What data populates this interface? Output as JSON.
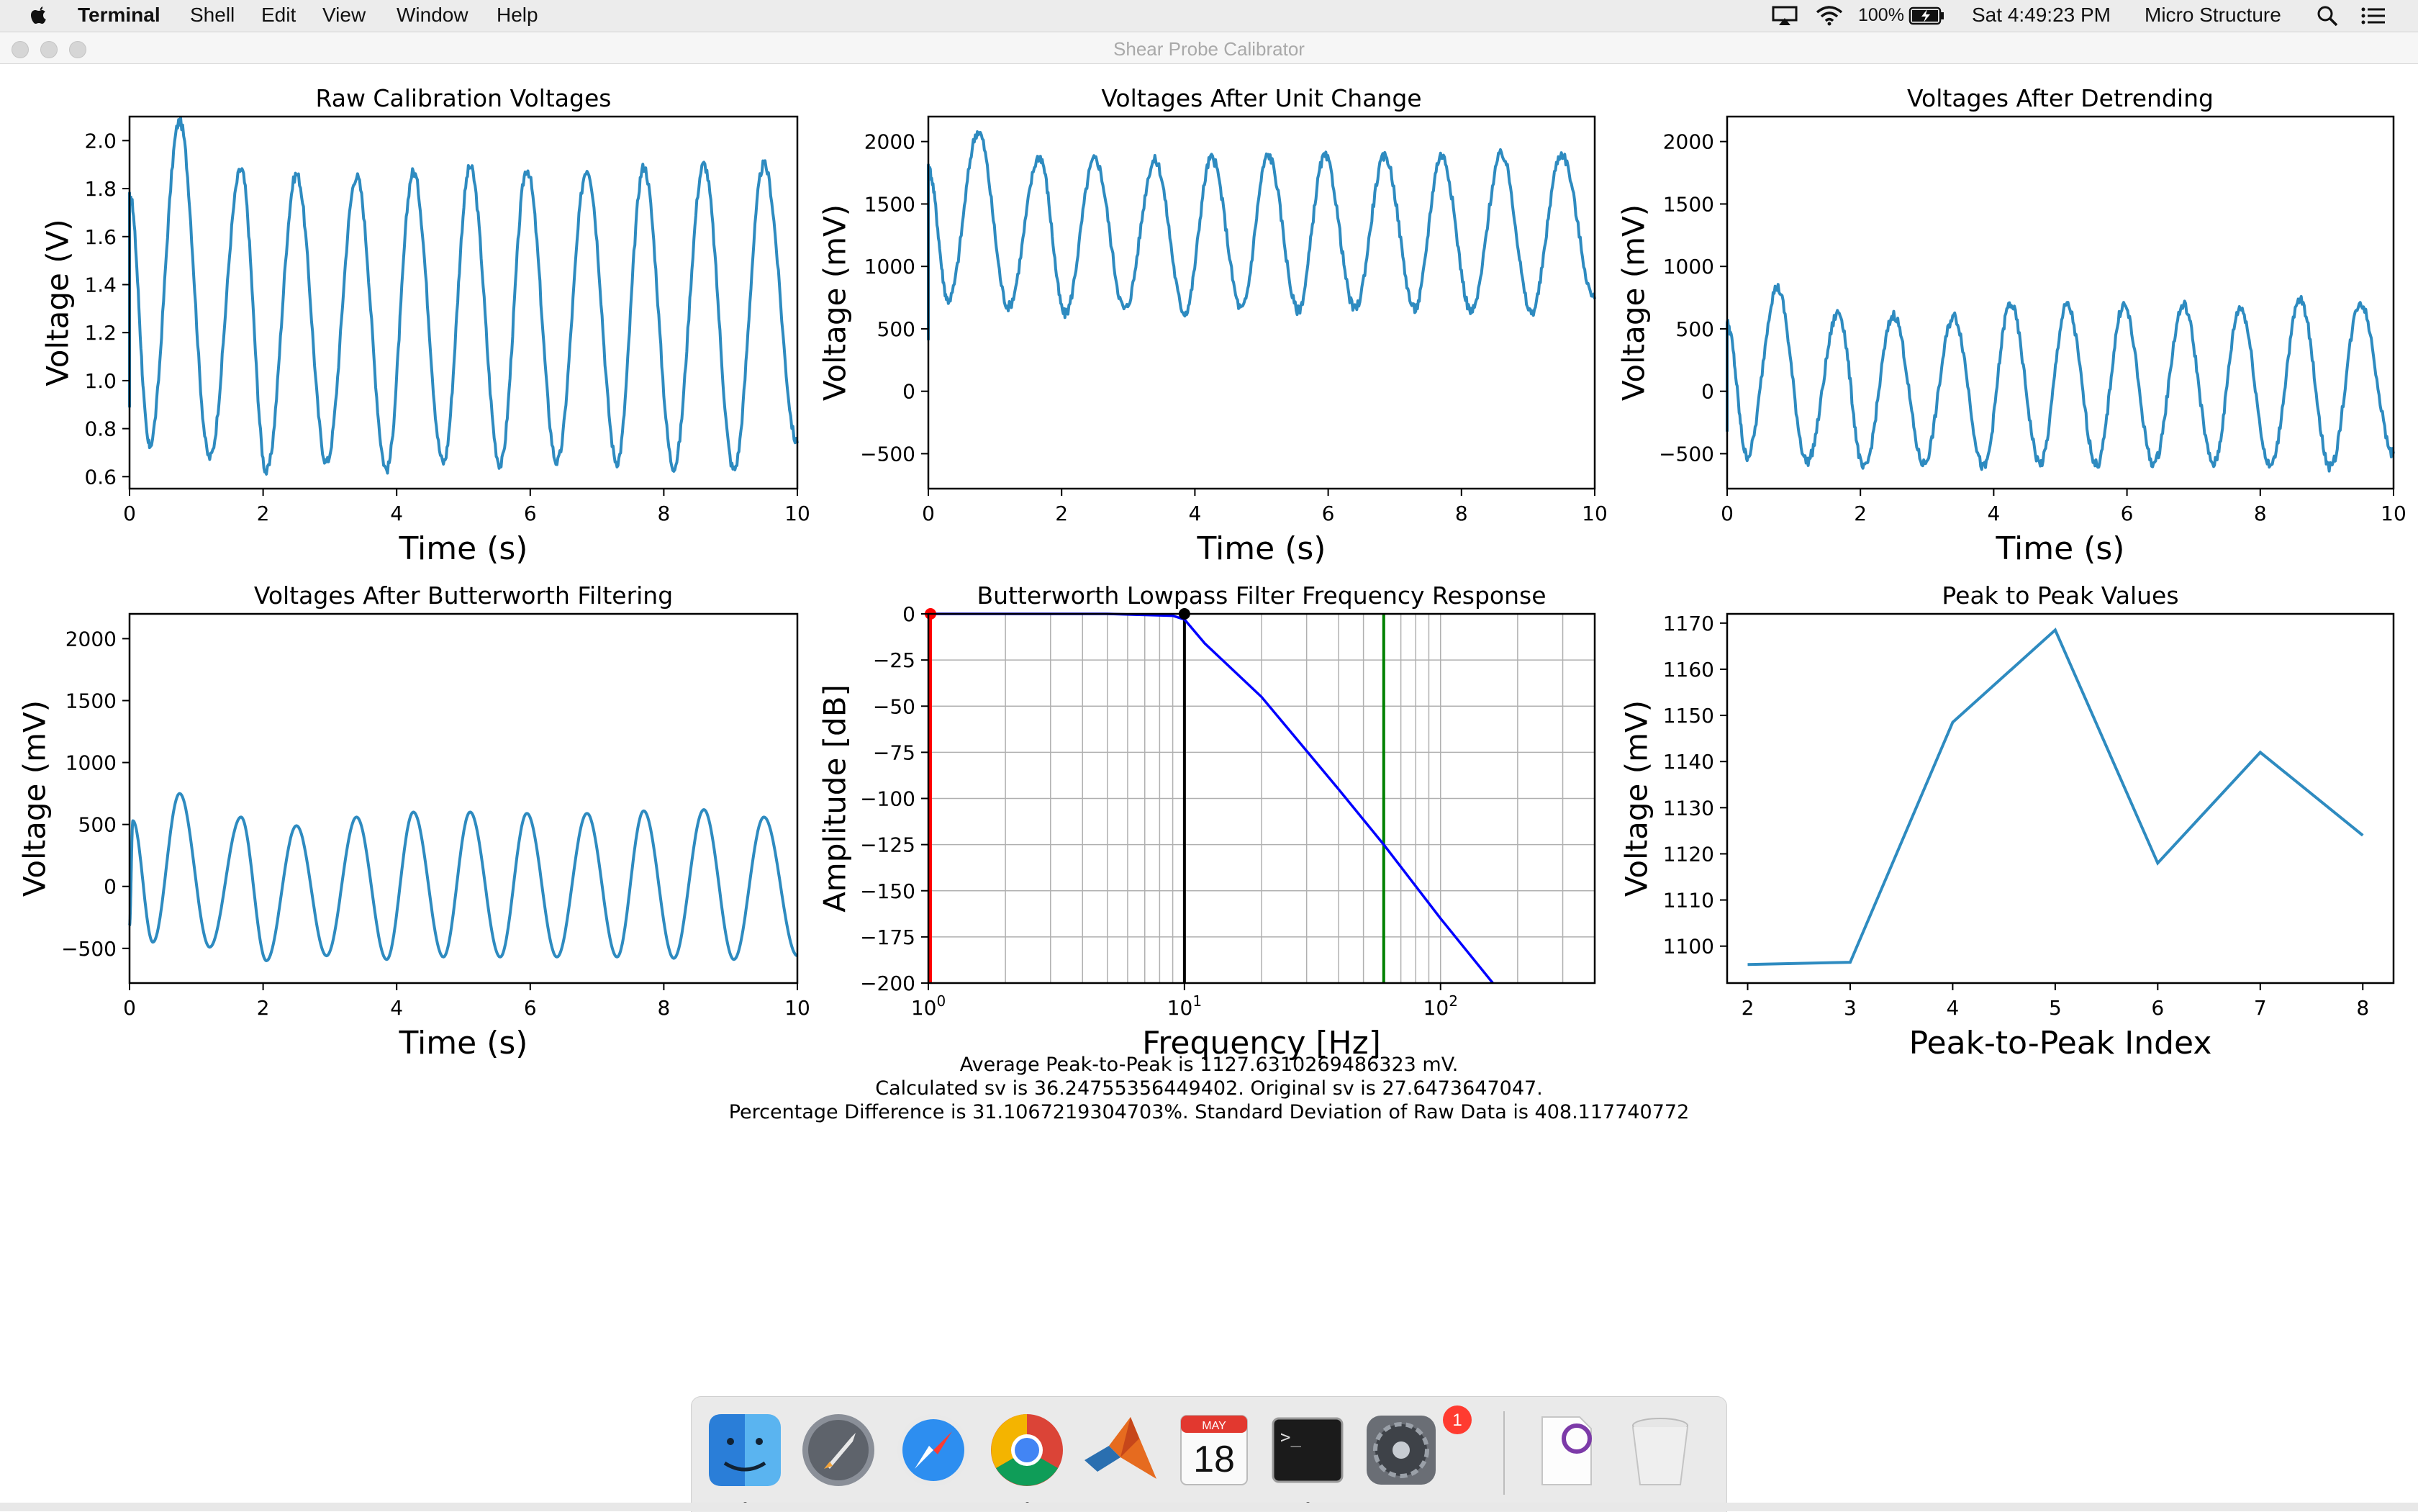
{
  "menubar": {
    "app_name": "Terminal",
    "items": [
      "Shell",
      "Edit",
      "View",
      "Window",
      "Help"
    ],
    "battery": "100%",
    "clock": "Sat 4:49:23 PM",
    "user": "Micro Structure",
    "icons": [
      "apple-icon",
      "airplay-icon",
      "wifi-icon",
      "battery-icon",
      "spotlight-search-icon",
      "notification-center-icon"
    ]
  },
  "window": {
    "title": "Shear Probe Calibrator"
  },
  "charts": {
    "raw": {
      "title": "Raw Calibration Voltages",
      "xlabel": "Time (s)",
      "ylabel": "Voltage (V)"
    },
    "unit": {
      "title": "Voltages After Unit Change",
      "xlabel": "Time (s)",
      "ylabel": "Voltage (mV)"
    },
    "detrend": {
      "title": "Voltages After Detrending",
      "xlabel": "Time (s)",
      "ylabel": "Voltage (mV)"
    },
    "butter": {
      "title": "Voltages After Butterworth Filtering",
      "xlabel": "Time (s)",
      "ylabel": "Voltage (mV)"
    },
    "freq": {
      "title": "Butterworth Lowpass Filter Frequency Response",
      "xlabel": "Frequency [Hz]",
      "ylabel": "Amplitude [dB]"
    },
    "p2p": {
      "title": "Peak to Peak Values",
      "xlabel": "Peak-to-Peak Index",
      "ylabel": "Voltage (mV)"
    }
  },
  "chart_data": [
    {
      "type": "line",
      "title": "Raw Calibration Voltages",
      "xlabel": "Time (s)",
      "ylabel": "Voltage (V)",
      "xlim": [
        0,
        10
      ],
      "ylim": [
        0.55,
        2.1
      ],
      "xticks": [
        "0",
        "2",
        "4",
        "6",
        "8",
        "10"
      ],
      "yticks": [
        "0.6",
        "0.8",
        "1.0",
        "1.2",
        "1.4",
        "1.6",
        "1.8",
        "2.0"
      ],
      "peak_times": [
        0.0,
        0.75,
        1.67,
        2.5,
        3.4,
        4.25,
        5.1,
        5.95,
        6.85,
        7.7,
        8.6,
        9.5
      ],
      "peaks": [
        1.78,
        2.08,
        1.88,
        1.86,
        1.85,
        1.87,
        1.89,
        1.88,
        1.88,
        1.89,
        1.9,
        1.9
      ],
      "trough_times": [
        0.3,
        1.2,
        2.05,
        2.95,
        3.85,
        4.7,
        5.55,
        6.4,
        7.3,
        8.15,
        9.05,
        10.0
      ],
      "troughs": [
        0.73,
        0.68,
        0.62,
        0.66,
        0.63,
        0.66,
        0.65,
        0.66,
        0.66,
        0.64,
        0.63,
        0.74
      ],
      "series": [
        {
          "values": "oscillating voltage, ~11 cycles over 10 s"
        }
      ],
      "color": "#2e8bc0"
    },
    {
      "type": "line",
      "title": "Voltages After Unit Change",
      "xlabel": "Time (s)",
      "ylabel": "Voltage (mV)",
      "xlim": [
        0,
        10
      ],
      "ylim": [
        -780,
        2200
      ],
      "xticks": [
        "0",
        "2",
        "4",
        "6",
        "8",
        "10"
      ],
      "yticks": [
        "−500",
        "0",
        "500",
        "1000",
        "1500",
        "2000"
      ],
      "peak_times": [
        0.0,
        0.75,
        1.67,
        2.5,
        3.4,
        4.25,
        5.1,
        5.95,
        6.85,
        7.7,
        8.6,
        9.5
      ],
      "peaks": [
        1780,
        2080,
        1880,
        1860,
        1850,
        1870,
        1890,
        1880,
        1880,
        1890,
        1900,
        1900
      ],
      "trough_times": [
        0.3,
        1.2,
        2.05,
        2.95,
        3.85,
        4.7,
        5.55,
        6.4,
        7.3,
        8.15,
        9.05,
        10.0
      ],
      "troughs": [
        730,
        680,
        620,
        660,
        630,
        660,
        650,
        660,
        660,
        640,
        630,
        740
      ],
      "color": "#2e8bc0"
    },
    {
      "type": "line",
      "title": "Voltages After Detrending",
      "xlabel": "Time (s)",
      "ylabel": "Voltage (mV)",
      "xlim": [
        0,
        10
      ],
      "ylim": [
        -780,
        2200
      ],
      "xticks": [
        "0",
        "2",
        "4",
        "6",
        "8",
        "10"
      ],
      "yticks": [
        "−500",
        "0",
        "500",
        "1000",
        "1500",
        "2000"
      ],
      "peak_times": [
        0.0,
        0.75,
        1.67,
        2.5,
        3.4,
        4.25,
        5.1,
        5.95,
        6.85,
        7.7,
        8.6,
        9.5
      ],
      "peaks": [
        540,
        830,
        630,
        610,
        600,
        700,
        690,
        690,
        690,
        670,
        730,
        710
      ],
      "trough_times": [
        0.3,
        1.2,
        2.05,
        2.95,
        3.85,
        4.7,
        5.55,
        6.4,
        7.3,
        8.15,
        9.05,
        10.0
      ],
      "troughs": [
        -520,
        -560,
        -620,
        -580,
        -610,
        -580,
        -590,
        -580,
        -580,
        -600,
        -610,
        -500
      ],
      "color": "#2e8bc0"
    },
    {
      "type": "line",
      "title": "Voltages After Butterworth Filtering",
      "xlabel": "Time (s)",
      "ylabel": "Voltage (mV)",
      "xlim": [
        0,
        10
      ],
      "ylim": [
        -780,
        2200
      ],
      "xticks": [
        "0",
        "2",
        "4",
        "6",
        "8",
        "10"
      ],
      "yticks": [
        "−500",
        "0",
        "500",
        "1000",
        "1500",
        "2000"
      ],
      "peak_times": [
        0.05,
        0.75,
        1.67,
        2.5,
        3.4,
        4.25,
        5.1,
        5.95,
        6.85,
        7.7,
        8.6,
        9.5
      ],
      "peaks": [
        530,
        750,
        560,
        490,
        560,
        600,
        600,
        590,
        590,
        610,
        620,
        560
      ],
      "trough_times": [
        0.35,
        1.2,
        2.05,
        2.95,
        3.85,
        4.7,
        5.55,
        6.4,
        7.3,
        8.15,
        9.05,
        10.0
      ],
      "troughs": [
        -450,
        -490,
        -600,
        -560,
        -590,
        -570,
        -570,
        -570,
        -570,
        -580,
        -590,
        -560
      ],
      "color": "#2e8bc0"
    },
    {
      "type": "line",
      "title": "Butterworth Lowpass Filter Frequency Response",
      "xlabel": "Frequency [Hz]",
      "ylabel": "Amplitude [dB]",
      "xscale": "log",
      "xlim": [
        1,
        400
      ],
      "ylim": [
        -200,
        0
      ],
      "xticks": [
        "10⁰",
        "10¹",
        "10²"
      ],
      "yticks": [
        "0",
        "−25",
        "−50",
        "−75",
        "−100",
        "−125",
        "−150",
        "−175",
        "−200"
      ],
      "grid": true,
      "response_x": [
        1,
        2,
        5,
        9,
        10,
        12,
        20,
        40,
        60,
        100,
        160
      ],
      "response_y": [
        0,
        0,
        0,
        -1,
        -3,
        -16,
        -45,
        -95,
        -125,
        -165,
        -200
      ],
      "vlines": [
        {
          "x": 1,
          "color": "#ff0000"
        },
        {
          "x": 10,
          "color": "#000000"
        },
        {
          "x": 60,
          "color": "#008000"
        }
      ],
      "markers": [
        {
          "x": 1,
          "y": 0,
          "color": "#ff0000"
        },
        {
          "x": 10,
          "y": 0,
          "color": "#000000"
        }
      ],
      "color": "#0000ff"
    },
    {
      "type": "line",
      "title": "Peak to Peak Values",
      "xlabel": "Peak-to-Peak Index",
      "ylabel": "Voltage (mV)",
      "xlim": [
        1.8,
        8.3
      ],
      "ylim": [
        1092,
        1172
      ],
      "xticks": [
        "2",
        "3",
        "4",
        "5",
        "6",
        "7",
        "8"
      ],
      "yticks": [
        "1100",
        "1110",
        "1120",
        "1130",
        "1140",
        "1150",
        "1160",
        "1170"
      ],
      "x": [
        2,
        3,
        4,
        5,
        6,
        7,
        8
      ],
      "values": [
        1096,
        1096.5,
        1148.5,
        1168.5,
        1118,
        1142,
        1124
      ],
      "color": "#2e8bc0"
    }
  ],
  "status": {
    "line1": "Average Peak-to-Peak is 1127.6310269486323 mV.",
    "line2": "Calculated sv is 36.24755356449402. Original sv is 27.6473647047.",
    "line3": "Percentage Difference is 31.1067219304703%. Standard Deviation of Raw Data is 408.117740772"
  },
  "dock": {
    "apps": [
      {
        "name": "finder-icon",
        "running": true
      },
      {
        "name": "launchpad-icon",
        "running": false
      },
      {
        "name": "safari-icon",
        "running": false
      },
      {
        "name": "chrome-icon",
        "running": true
      },
      {
        "name": "matlab-icon",
        "running": false
      },
      {
        "name": "calendar-icon",
        "running": false
      },
      {
        "name": "terminal-icon",
        "running": true
      },
      {
        "name": "system-preferences-icon",
        "running": false
      },
      {
        "name": "document-icon",
        "running": false
      },
      {
        "name": "trash-icon",
        "running": false
      }
    ],
    "calendar_month": "MAY",
    "calendar_day": "18",
    "terminal_prompt": ">_",
    "badge": "1"
  }
}
